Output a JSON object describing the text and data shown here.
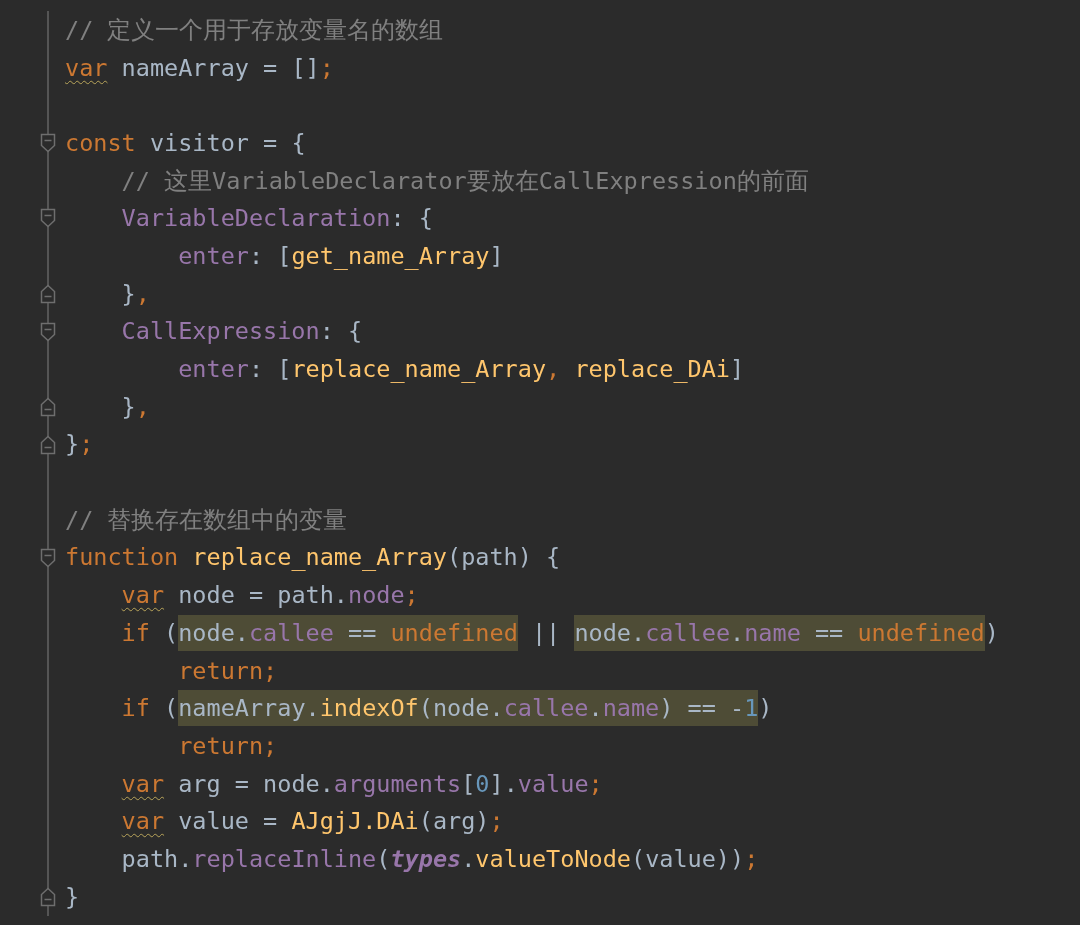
{
  "editor": {
    "lines": [
      {
        "kind": "code",
        "tokens": [
          {
            "kind": "comment",
            "text": "// 定义一个用于存放变量名的数组"
          }
        ]
      },
      {
        "kind": "code",
        "tokens": [
          {
            "kind": "keyword-warn",
            "text": "var"
          },
          {
            "kind": "plain",
            "text": " nameArray = []"
          },
          {
            "kind": "keyword",
            "text": ";"
          }
        ]
      },
      {
        "kind": "blank"
      },
      {
        "kind": "code",
        "fold_marker": {
          "kind": "start"
        },
        "tokens": [
          {
            "kind": "keyword",
            "text": "const"
          },
          {
            "kind": "plain",
            "text": " visitor = {"
          }
        ]
      },
      {
        "kind": "code",
        "tokens": [
          {
            "kind": "comment",
            "text": "    // 这里VariableDeclarator要放在CallExpression的前面"
          }
        ]
      },
      {
        "kind": "code",
        "fold_marker": {
          "kind": "start"
        },
        "tokens": [
          {
            "kind": "property",
            "text": "    VariableDeclaration"
          },
          {
            "kind": "plain",
            "text": ": {"
          }
        ]
      },
      {
        "kind": "code",
        "tokens": [
          {
            "kind": "property",
            "text": "        enter"
          },
          {
            "kind": "plain",
            "text": ": ["
          },
          {
            "kind": "function",
            "text": "get_name_Array"
          },
          {
            "kind": "plain",
            "text": "]"
          }
        ]
      },
      {
        "kind": "code",
        "fold_marker": {
          "kind": "end"
        },
        "tokens": [
          {
            "kind": "plain",
            "text": "    }"
          },
          {
            "kind": "keyword",
            "text": ","
          }
        ]
      },
      {
        "kind": "code",
        "fold_marker": {
          "kind": "start"
        },
        "tokens": [
          {
            "kind": "property",
            "text": "    CallExpression"
          },
          {
            "kind": "plain",
            "text": ": {"
          }
        ]
      },
      {
        "kind": "code",
        "tokens": [
          {
            "kind": "property",
            "text": "        enter"
          },
          {
            "kind": "plain",
            "text": ": ["
          },
          {
            "kind": "function",
            "text": "replace_name_Array"
          },
          {
            "kind": "keyword",
            "text": ","
          },
          {
            "kind": "function",
            "text": " replace_DAi"
          },
          {
            "kind": "plain",
            "text": "]"
          }
        ]
      },
      {
        "kind": "code",
        "fold_marker": {
          "kind": "end"
        },
        "tokens": [
          {
            "kind": "plain",
            "text": "    }"
          },
          {
            "kind": "keyword",
            "text": ","
          }
        ]
      },
      {
        "kind": "code",
        "fold_marker": {
          "kind": "end"
        },
        "tokens": [
          {
            "kind": "plain",
            "text": "}"
          },
          {
            "kind": "keyword",
            "text": ";"
          }
        ]
      },
      {
        "kind": "blank"
      },
      {
        "kind": "code",
        "tokens": [
          {
            "kind": "comment",
            "text": "// 替换存在数组中的变量"
          }
        ]
      },
      {
        "kind": "code",
        "fold_marker": {
          "kind": "start"
        },
        "tokens": [
          {
            "kind": "keyword",
            "text": "function"
          },
          {
            "kind": "function",
            "text": " replace_name_Array"
          },
          {
            "kind": "plain",
            "text": "(path) {"
          }
        ]
      },
      {
        "kind": "code",
        "tokens": [
          {
            "kind": "keyword-warn",
            "text": "    var"
          },
          {
            "kind": "plain",
            "text": " node = path."
          },
          {
            "kind": "property",
            "text": "node"
          },
          {
            "kind": "keyword",
            "text": ";"
          }
        ]
      },
      {
        "kind": "code",
        "tokens": [
          {
            "kind": "keyword",
            "text": "    if"
          },
          {
            "kind": "plain",
            "text": " ("
          },
          {
            "kind": "match",
            "tokens": [
              {
                "kind": "plain",
                "text": "node."
              },
              {
                "kind": "property",
                "text": "callee"
              },
              {
                "kind": "plain",
                "text": " == "
              },
              {
                "kind": "keyword",
                "text": "undefined"
              }
            ]
          },
          {
            "kind": "plain",
            "text": " || "
          },
          {
            "kind": "match",
            "tokens": [
              {
                "kind": "plain",
                "text": "node."
              },
              {
                "kind": "property",
                "text": "callee"
              },
              {
                "kind": "plain",
                "text": "."
              },
              {
                "kind": "property",
                "text": "name"
              },
              {
                "kind": "plain",
                "text": " == "
              },
              {
                "kind": "keyword",
                "text": "undefined"
              }
            ]
          },
          {
            "kind": "plain",
            "text": ")"
          }
        ]
      },
      {
        "kind": "code",
        "tokens": [
          {
            "kind": "keyword",
            "text": "        return;"
          }
        ]
      },
      {
        "kind": "code",
        "tokens": [
          {
            "kind": "keyword",
            "text": "    if"
          },
          {
            "kind": "plain",
            "text": " ("
          },
          {
            "kind": "match",
            "tokens": [
              {
                "kind": "plain",
                "text": "nameArray."
              },
              {
                "kind": "function",
                "text": "indexOf"
              },
              {
                "kind": "plain",
                "text": "(node."
              },
              {
                "kind": "property",
                "text": "callee"
              },
              {
                "kind": "plain",
                "text": "."
              },
              {
                "kind": "property",
                "text": "name"
              },
              {
                "kind": "plain",
                "text": ") == -"
              },
              {
                "kind": "number",
                "text": "1"
              }
            ]
          },
          {
            "kind": "plain",
            "text": ")"
          }
        ]
      },
      {
        "kind": "code",
        "tokens": [
          {
            "kind": "keyword",
            "text": "        return;"
          }
        ]
      },
      {
        "kind": "code",
        "tokens": [
          {
            "kind": "keyword-warn",
            "text": "    var"
          },
          {
            "kind": "plain",
            "text": " arg = node."
          },
          {
            "kind": "property",
            "text": "arguments"
          },
          {
            "kind": "plain",
            "text": "["
          },
          {
            "kind": "number",
            "text": "0"
          },
          {
            "kind": "plain",
            "text": "]."
          },
          {
            "kind": "property",
            "text": "value"
          },
          {
            "kind": "keyword",
            "text": ";"
          }
        ]
      },
      {
        "kind": "code",
        "tokens": [
          {
            "kind": "keyword-warn",
            "text": "    var"
          },
          {
            "kind": "plain",
            "text": " value = "
          },
          {
            "kind": "function",
            "text": "AJgjJ.DAi"
          },
          {
            "kind": "plain",
            "text": "(arg)"
          },
          {
            "kind": "keyword",
            "text": ";"
          }
        ]
      },
      {
        "kind": "code",
        "tokens": [
          {
            "kind": "plain",
            "text": "    path."
          },
          {
            "kind": "property",
            "text": "replaceInline"
          },
          {
            "kind": "plain",
            "text": "("
          },
          {
            "kind": "italic-property",
            "text": "types"
          },
          {
            "kind": "plain",
            "text": "."
          },
          {
            "kind": "function",
            "text": "valueToNode"
          },
          {
            "kind": "plain",
            "text": "(value))"
          },
          {
            "kind": "keyword",
            "text": ";"
          }
        ]
      },
      {
        "kind": "code",
        "fold_marker": {
          "kind": "end"
        },
        "tokens": [
          {
            "kind": "plain",
            "text": "}"
          }
        ]
      }
    ]
  }
}
